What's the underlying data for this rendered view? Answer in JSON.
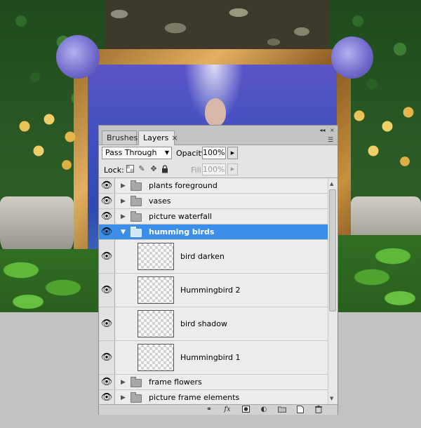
{
  "tabs": [
    {
      "label": "Brushes",
      "close": ""
    },
    {
      "label": "Layers",
      "close": "×"
    }
  ],
  "panel_controls": {
    "minimize": "◂◂",
    "close": "×",
    "menu": "☰"
  },
  "blend_mode": {
    "value": "Pass Through"
  },
  "opacity": {
    "label": "Opacity:",
    "value": "100%"
  },
  "lock": {
    "label": "Lock:"
  },
  "fill": {
    "label": "Fill:",
    "value": "100%"
  },
  "layers": [
    {
      "name": "plants foreground",
      "type": "group",
      "expanded": false,
      "visible": true,
      "selected": false
    },
    {
      "name": "vases",
      "type": "group",
      "expanded": false,
      "visible": true,
      "selected": false
    },
    {
      "name": "picture waterfall",
      "type": "group",
      "expanded": false,
      "visible": true,
      "selected": false
    },
    {
      "name": "humming birds",
      "type": "group",
      "expanded": true,
      "visible": true,
      "selected": true
    },
    {
      "name": "bird darken",
      "type": "layer",
      "visible": true
    },
    {
      "name": "Hummingbird 2",
      "type": "layer",
      "visible": true
    },
    {
      "name": "bird shadow",
      "type": "layer",
      "visible": true
    },
    {
      "name": "Hummingbird 1",
      "type": "layer",
      "visible": true
    },
    {
      "name": "frame flowers",
      "type": "group",
      "expanded": false,
      "visible": true,
      "selected": false
    },
    {
      "name": "picture frame elements",
      "type": "group",
      "expanded": false,
      "visible": true,
      "selected": false
    }
  ],
  "footer_buttons": [
    "link-layers-icon",
    "fx-icon",
    "add-mask-icon",
    "adjustment-layer-icon",
    "new-group-icon",
    "new-layer-icon",
    "trash-icon"
  ],
  "colors": {
    "selection": "#3c8fe8",
    "panel": "#d6d6d6"
  }
}
